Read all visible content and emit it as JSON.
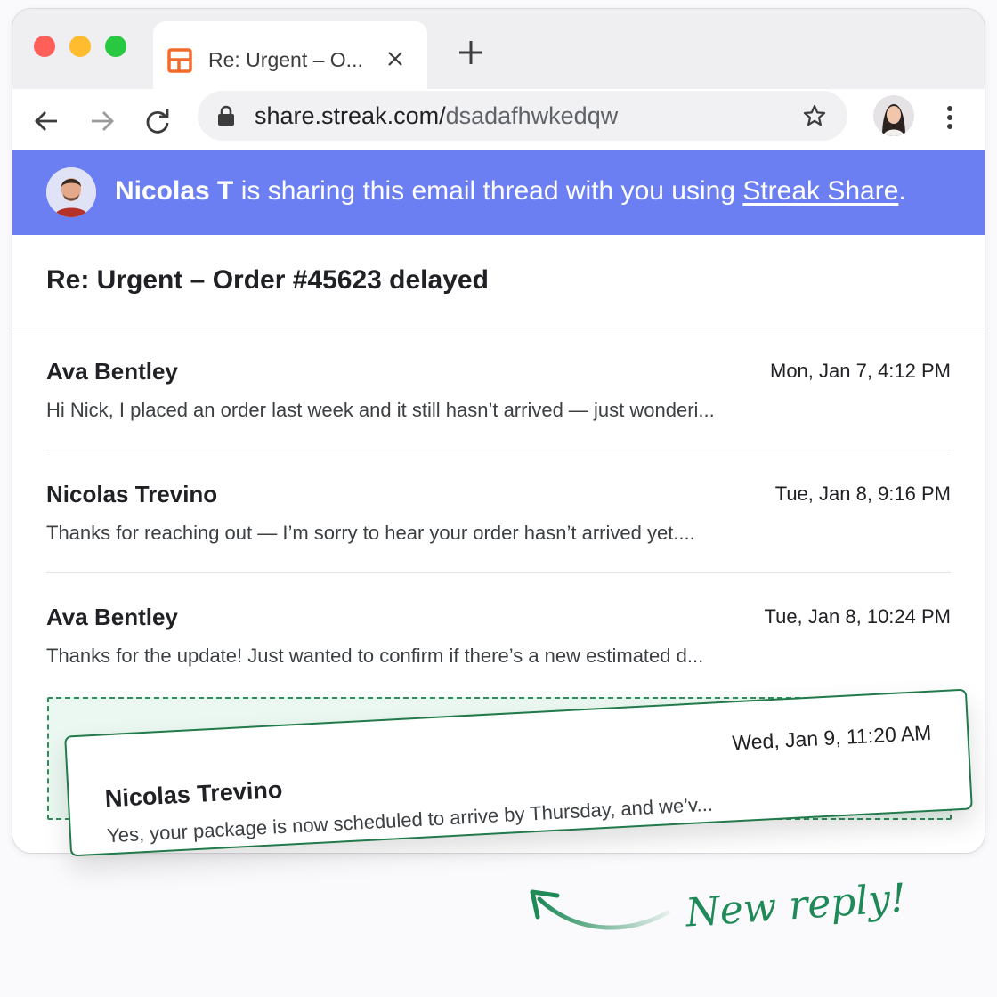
{
  "browser": {
    "tab_title": "Re: Urgent – O...",
    "url_host": "share.streak.com/",
    "url_path": "dsadafhwkedqw",
    "icons": [
      "streak-tab-icon",
      "close-icon",
      "plus-icon",
      "back-icon",
      "forward-icon",
      "reload-icon",
      "lock-icon",
      "star-icon",
      "profile-avatar",
      "kebab-menu-icon"
    ]
  },
  "banner": {
    "sharer": "Nicolas T",
    "text": " is sharing this email thread with you using ",
    "link": "Streak Share",
    "period": ".",
    "color": "#6b7ff2"
  },
  "thread": {
    "subject": "Re: Urgent – Order #45623 delayed",
    "messages": [
      {
        "sender": "Ava Bentley",
        "date": "Mon, Jan 7, 4:12 PM",
        "preview": "Hi Nick, I placed an order last week and it still hasn’t arrived — just wonderi..."
      },
      {
        "sender": "Nicolas Trevino",
        "date": "Tue, Jan 8, 9:16 PM",
        "preview": "Thanks for reaching out — I’m sorry to hear your order hasn’t arrived yet...."
      },
      {
        "sender": "Ava Bentley",
        "date": "Tue, Jan 8, 10:24 PM",
        "preview": "Thanks for the update! Just wanted to confirm if there’s a new estimated d..."
      }
    ],
    "new_message": {
      "sender": "Nicolas Trevino",
      "date": "Wed, Jan 9, 11:20 AM",
      "preview": "Yes, your package is now scheduled to arrive by Thursday, and we’v..."
    }
  },
  "annotation": {
    "label": "New reply!",
    "color": "#1f8a58"
  }
}
